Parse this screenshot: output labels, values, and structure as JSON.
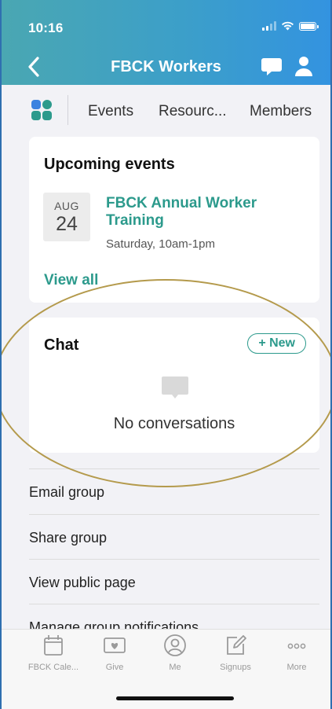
{
  "status_bar": {
    "time": "10:16"
  },
  "nav": {
    "title": "FBCK Workers"
  },
  "tabs": [
    {
      "label": "Events"
    },
    {
      "label": "Resourc..."
    },
    {
      "label": "Members"
    }
  ],
  "upcoming_events": {
    "title": "Upcoming events",
    "event": {
      "month": "AUG",
      "day": "24",
      "title": "FBCK Annual Worker Training",
      "time": "Saturday, 10am-1pm"
    },
    "view_all_label": "View all"
  },
  "chat": {
    "title": "Chat",
    "new_button_label": "+ New",
    "empty_text": "No conversations"
  },
  "options": [
    {
      "label": "Email group"
    },
    {
      "label": "Share group"
    },
    {
      "label": "View public page"
    },
    {
      "label": "Manage group notifications"
    }
  ],
  "bottom_nav": [
    {
      "label": "FBCK Cale...",
      "icon": "calendar-icon"
    },
    {
      "label": "Give",
      "icon": "give-icon"
    },
    {
      "label": "Me",
      "icon": "person-circle-icon"
    },
    {
      "label": "Signups",
      "icon": "edit-icon"
    },
    {
      "label": "More",
      "icon": "more-icon"
    }
  ],
  "colors": {
    "accent": "#2c9a8c",
    "header_gradient_start": "#4aa7b2",
    "header_gradient_end": "#3393e0",
    "highlight": "#b49a4c"
  }
}
